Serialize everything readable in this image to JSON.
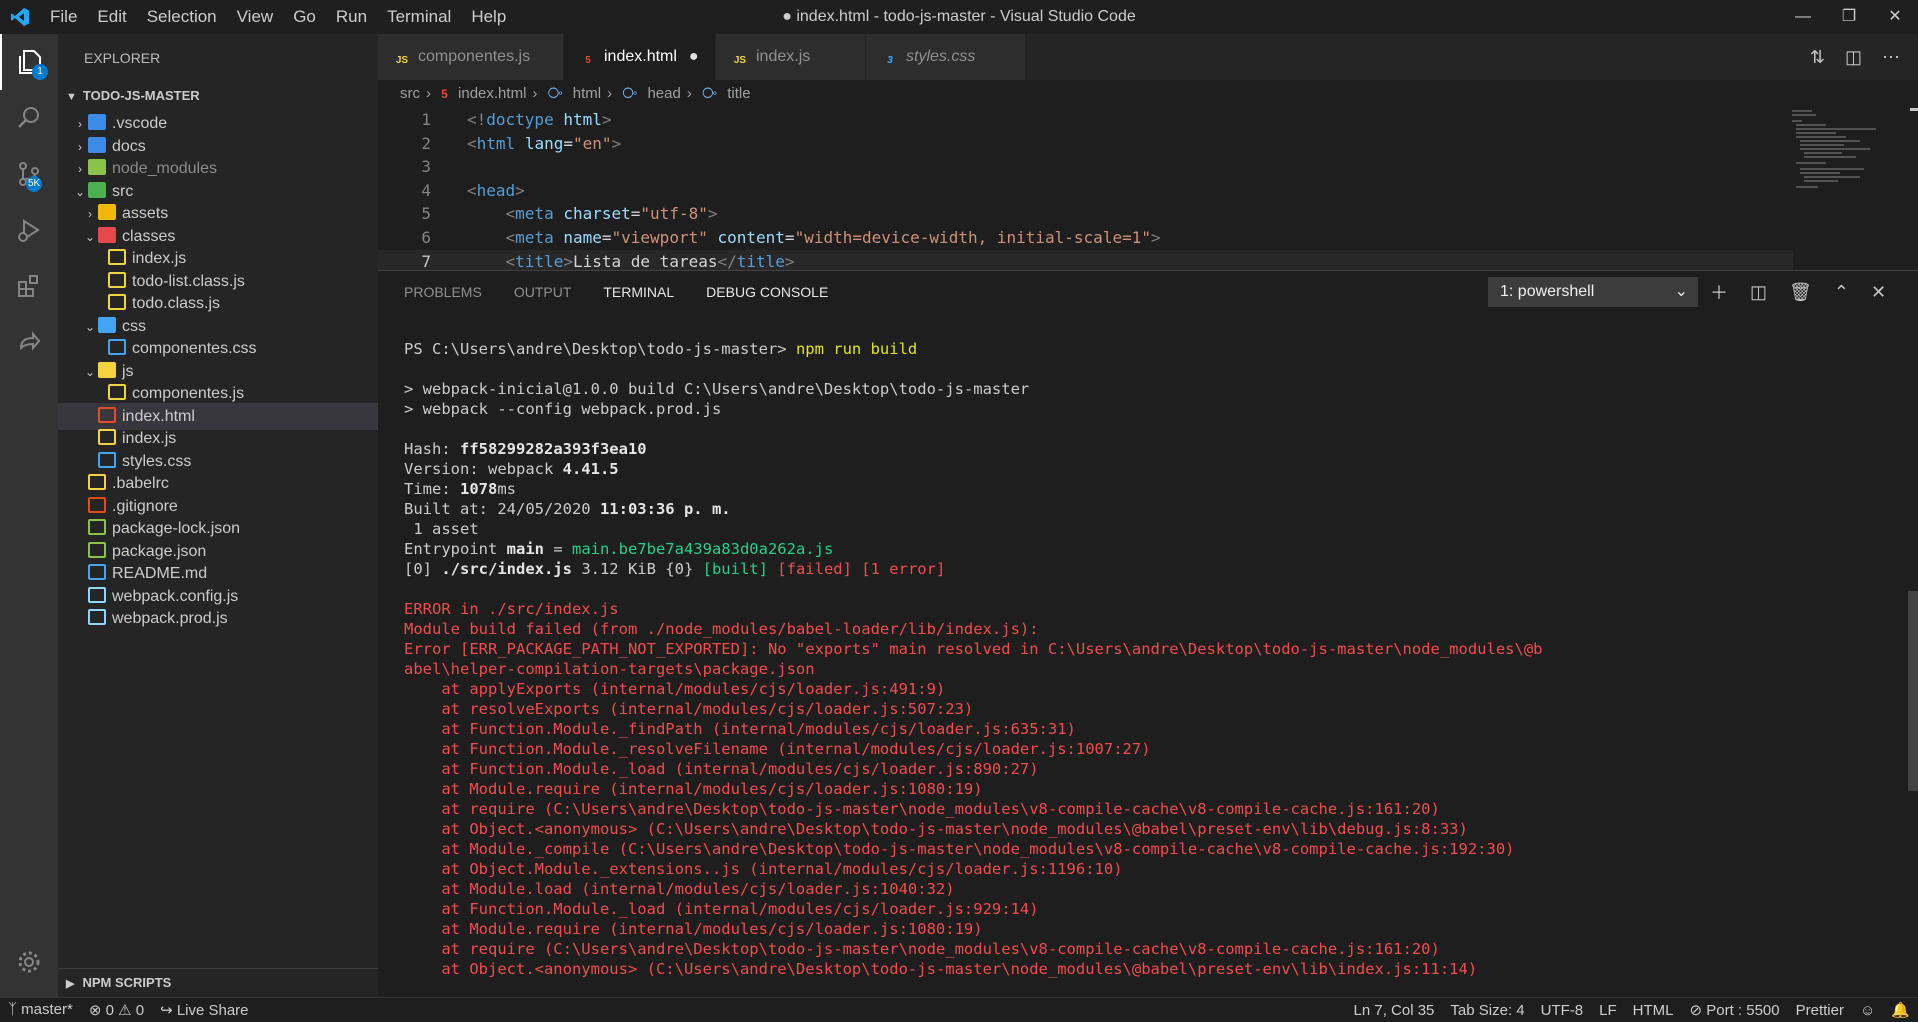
{
  "titlebar": {
    "menu": [
      "File",
      "Edit",
      "Selection",
      "View",
      "Go",
      "Run",
      "Terminal",
      "Help"
    ],
    "title": "● index.html - todo-js-master - Visual Studio Code"
  },
  "activity": {
    "explorer_badge": "1",
    "scm_badge": "5K"
  },
  "explorer": {
    "header": "EXPLORER",
    "root": "TODO-JS-MASTER",
    "items": [
      {
        "label": ".vscode",
        "kind": "folder",
        "color": "#3d8be8"
      },
      {
        "label": "docs",
        "kind": "folder",
        "color": "#3d8be8"
      },
      {
        "label": "node_modules",
        "kind": "folder",
        "color": "#8bc34a"
      },
      {
        "label": "src",
        "kind": "folder",
        "color": "#4caf50"
      },
      {
        "label": "assets",
        "kind": "folder",
        "color": "#f2b807"
      },
      {
        "label": "classes",
        "kind": "folder",
        "color": "#e44a4a"
      },
      {
        "label": "index.js",
        "kind": "file",
        "color": "#f5d33f"
      },
      {
        "label": "todo-list.class.js",
        "kind": "file",
        "color": "#f5d33f"
      },
      {
        "label": "todo.class.js",
        "kind": "file",
        "color": "#f5d33f"
      },
      {
        "label": "css",
        "kind": "folder",
        "color": "#42a5f5"
      },
      {
        "label": "componentes.css",
        "kind": "file",
        "color": "#42a5f5"
      },
      {
        "label": "js",
        "kind": "folder",
        "color": "#f5d33f"
      },
      {
        "label": "componentes.js",
        "kind": "file",
        "color": "#f5d33f"
      },
      {
        "label": "index.html",
        "kind": "file",
        "color": "#e44d26"
      },
      {
        "label": "index.js",
        "kind": "file",
        "color": "#f5d33f"
      },
      {
        "label": "styles.css",
        "kind": "file",
        "color": "#42a5f5"
      },
      {
        "label": ".babelrc",
        "kind": "file",
        "color": "#f5d33f"
      },
      {
        "label": ".gitignore",
        "kind": "file",
        "color": "#e64a19"
      },
      {
        "label": "package-lock.json",
        "kind": "file",
        "color": "#8bc34a"
      },
      {
        "label": "package.json",
        "kind": "file",
        "color": "#8bc34a"
      },
      {
        "label": "README.md",
        "kind": "file",
        "color": "#42a5f5"
      },
      {
        "label": "webpack.config.js",
        "kind": "file",
        "color": "#8ed6fb"
      },
      {
        "label": "webpack.prod.js",
        "kind": "file",
        "color": "#8ed6fb"
      }
    ],
    "npm_section": "NPM SCRIPTS"
  },
  "tabs": [
    "componentes.js",
    "index.html",
    "index.js",
    "styles.css"
  ],
  "breadcrumb": [
    "src",
    "index.html",
    "html",
    "head",
    "title"
  ],
  "code": {
    "line_numbers": [
      "1",
      "2",
      "3",
      "4",
      "5",
      "6",
      "7"
    ],
    "l1_doctype": "doctype",
    "l1_html": "html",
    "l2_tag": "html",
    "l2_attr": "lang",
    "l2_val": "\"en\"",
    "l4_tag": "head",
    "l5_tag": "meta",
    "l5_attr": "charset",
    "l5_val": "\"utf-8\"",
    "l6_tag": "meta",
    "l6_attr1": "name",
    "l6_val1": "\"viewport\"",
    "l6_attr2": "content",
    "l6_val2": "\"width=device-width, initial-scale=1\"",
    "l7_tag": "title",
    "l7_text": "Lista de tareas",
    "l7_close": "title"
  },
  "panel": {
    "tabs": [
      "PROBLEMS",
      "OUTPUT",
      "TERMINAL",
      "DEBUG CONSOLE"
    ],
    "shell": "1: powershell"
  },
  "terminal": {
    "prompt": "PS C:\\Users\\andre\\Desktop\\todo-js-master> ",
    "command": "npm run build",
    "script1": "> webpack-inicial@1.0.0 build C:\\Users\\andre\\Desktop\\todo-js-master",
    "script2": "> webpack --config webpack.prod.js",
    "hash_label": "Hash: ",
    "hash": "ff58299282a393f3ea10",
    "version_label": "Version: webpack ",
    "version": "4.41.5",
    "time_label": "Time: ",
    "time": "1078",
    "time_unit": "ms",
    "built_label": "Built at: 24/05/2020 ",
    "built_time": "11:03:36 p. m.",
    "asset_line": " 1 asset",
    "entry_label": "Entrypoint ",
    "entry_name": "main",
    "entry_eq": " = ",
    "entry_file": "main.be7be7a439a83d0a262a.js",
    "chunk_pre": "[0] ",
    "chunk_file": "./src/index.js",
    "chunk_mid": " 3.12 KiB {0} ",
    "chunk_built": "[built]",
    "chunk_failed": " [failed] [1 error]",
    "errors": [
      "ERROR in ./src/index.js",
      "Module build failed (from ./node_modules/babel-loader/lib/index.js):",
      "Error [ERR_PACKAGE_PATH_NOT_EXPORTED]: No \"exports\" main resolved in C:\\Users\\andre\\Desktop\\todo-js-master\\node_modules\\@b",
      "abel\\helper-compilation-targets\\package.json",
      "    at applyExports (internal/modules/cjs/loader.js:491:9)",
      "    at resolveExports (internal/modules/cjs/loader.js:507:23)",
      "    at Function.Module._findPath (internal/modules/cjs/loader.js:635:31)",
      "    at Function.Module._resolveFilename (internal/modules/cjs/loader.js:1007:27)",
      "    at Function.Module._load (internal/modules/cjs/loader.js:890:27)",
      "    at Module.require (internal/modules/cjs/loader.js:1080:19)",
      "    at require (C:\\Users\\andre\\Desktop\\todo-js-master\\node_modules\\v8-compile-cache\\v8-compile-cache.js:161:20)",
      "    at Object.<anonymous> (C:\\Users\\andre\\Desktop\\todo-js-master\\node_modules\\@babel\\preset-env\\lib\\debug.js:8:33)",
      "    at Module._compile (C:\\Users\\andre\\Desktop\\todo-js-master\\node_modules\\v8-compile-cache\\v8-compile-cache.js:192:30)",
      "    at Object.Module._extensions..js (internal/modules/cjs/loader.js:1196:10)",
      "    at Module.load (internal/modules/cjs/loader.js:1040:32)",
      "    at Function.Module._load (internal/modules/cjs/loader.js:929:14)",
      "    at Module.require (internal/modules/cjs/loader.js:1080:19)",
      "    at require (C:\\Users\\andre\\Desktop\\todo-js-master\\node_modules\\v8-compile-cache\\v8-compile-cache.js:161:20)",
      "    at Object.<anonymous> (C:\\Users\\andre\\Desktop\\todo-js-master\\node_modules\\@babel\\preset-env\\lib\\index.js:11:14)"
    ]
  },
  "status": {
    "branch": "master*",
    "problems": "⊗ 0 ⚠ 0",
    "live_share": "Live Share",
    "position": "Ln 7, Col 35",
    "tab_size": "Tab Size: 4",
    "encoding": "UTF-8",
    "eol": "LF",
    "language": "HTML",
    "port": "Port : 5500",
    "formatter": "Prettier"
  }
}
